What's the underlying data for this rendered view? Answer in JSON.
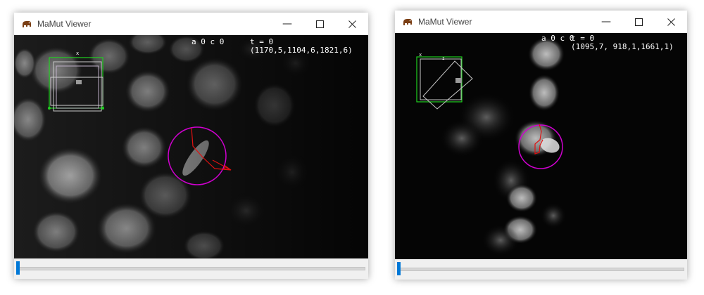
{
  "windows": [
    {
      "title": "MaMut Viewer",
      "overlay": {
        "axes_label": "a 0 c 0",
        "time": "t = 0",
        "coords": "(1170,5,1104,6,1821,6)"
      },
      "timeline": {
        "position": 0
      }
    },
    {
      "title": "MaMut Viewer",
      "overlay": {
        "axes_label": "a 0 c 0",
        "time": "t = 0",
        "coords": "(1095,7, 918,1,1661,1)"
      },
      "timeline": {
        "position": 0
      }
    }
  ],
  "icons": {
    "app": "elephant-icon",
    "minimize": "minimize-icon",
    "maximize": "maximize-icon",
    "close": "close-icon"
  },
  "colors": {
    "spot_circle": "#d000d0",
    "track_line": "#e01010",
    "bbox_active": "#20d020",
    "bbox_outline": "#c8c8c8",
    "slider_thumb": "#0078d7"
  }
}
